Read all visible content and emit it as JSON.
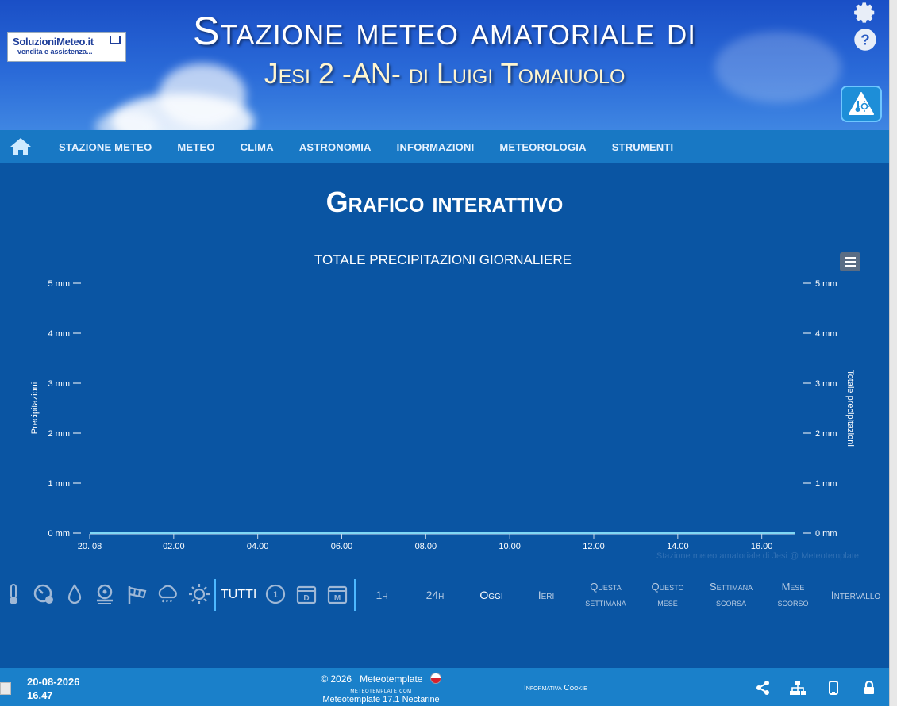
{
  "header": {
    "logo_line1": "SoluzioniMeteo.it",
    "logo_line2": "vendita e assistenza...",
    "title_line1": "Stazione meteo amatoriale di",
    "title_line2": "Jesi 2 -AN- di Luigi Tomaiuolo",
    "icons": [
      "gear-icon",
      "help-icon",
      "weather-app-icon"
    ]
  },
  "nav": {
    "home_icon": "home-icon",
    "items": [
      "STAZIONE METEO",
      "METEO",
      "CLIMA",
      "ASTRONOMIA",
      "INFORMAZIONI",
      "METEOROLOGIA",
      "STRUMENTI"
    ]
  },
  "main": {
    "page_title": "Grafico interattivo"
  },
  "chart_data": {
    "type": "line",
    "title": "TOTALE PRECIPITAZIONI GIORNALIERE",
    "ylabel_left": "Precipitazioni",
    "ylabel_right": "Totale precipitazioni",
    "y_ticks": [
      "0 mm",
      "1 mm",
      "2 mm",
      "3 mm",
      "4 mm",
      "5 mm"
    ],
    "ylim": [
      0,
      5
    ],
    "x_ticks": [
      "20. 08",
      "02.00",
      "04.00",
      "06.00",
      "08.00",
      "10.00",
      "12.00",
      "14.00",
      "16.00"
    ],
    "x_range_hours": [
      0,
      16.8
    ],
    "series": [
      {
        "x": [
          0,
          16.8
        ],
        "values": [
          0,
          0
        ]
      }
    ],
    "credits": "Stazione meteo amatoriale di Jesi @ Meteotemplate",
    "colors": {
      "series": "#7fd8f5"
    }
  },
  "controls": {
    "sensor_icons": [
      "thermometer-icon",
      "pressure-gauge-icon",
      "humidity-drop-icon",
      "wind-speed-icon",
      "wind-sock-icon",
      "rain-cloud-icon",
      "sun-icon"
    ],
    "all_label": "TUTTI",
    "period_icons": [
      "clock-icon",
      "day-calendar-icon",
      "month-calendar-icon"
    ],
    "period_icon_letters": [
      "1",
      "D",
      "M"
    ],
    "range_buttons": [
      "1h",
      "24h",
      "Oggi",
      "Ieri",
      "Questa settimana",
      "Questo mese",
      "Settimana scorsa",
      "Mese scorso",
      "Intervallo"
    ]
  },
  "footer": {
    "date": "20-08-2026",
    "time": "16.47",
    "copyright": "© 2026",
    "brand": "Meteotemplate",
    "site": "meteotemplate.com",
    "version": "Meteotemplate 17.1 Nectarine",
    "cookie": "Informativa Cookie",
    "icons": [
      "share-icon",
      "sitemap-icon",
      "mobile-icon",
      "lock-icon"
    ]
  }
}
